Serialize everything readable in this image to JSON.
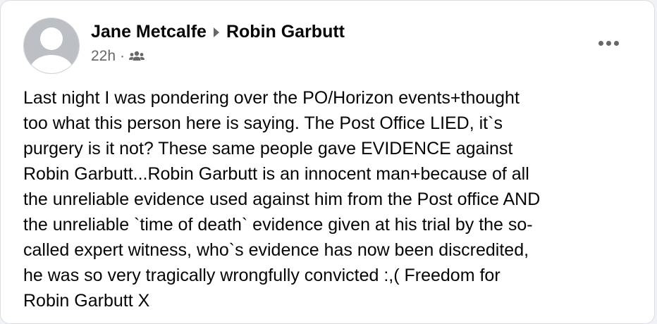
{
  "post": {
    "author_name": "Jane Metcalfe",
    "recipient_name": "Robin Garbutt",
    "timestamp": "22h",
    "separator": "·",
    "audience_icon": "friends-icon",
    "more_icon": "more-options-icon",
    "body_text": "Last night I was pondering over the PO/Horizon events+thought\ntoo what this person here is saying. The Post Office LIED, it`s\npurgery is it not? These same people gave EVIDENCE against\nRobin Garbutt...Robin Garbutt is an innocent man+because of all\nthe unreliable evidence used against him from the Post office AND\nthe unreliable `time of death` evidence given at his trial by the so-\ncalled expert witness, who`s evidence has now been discredited,\nhe was so very tragically wrongfully convicted :,( Freedom for\nRobin Garbutt X"
  }
}
